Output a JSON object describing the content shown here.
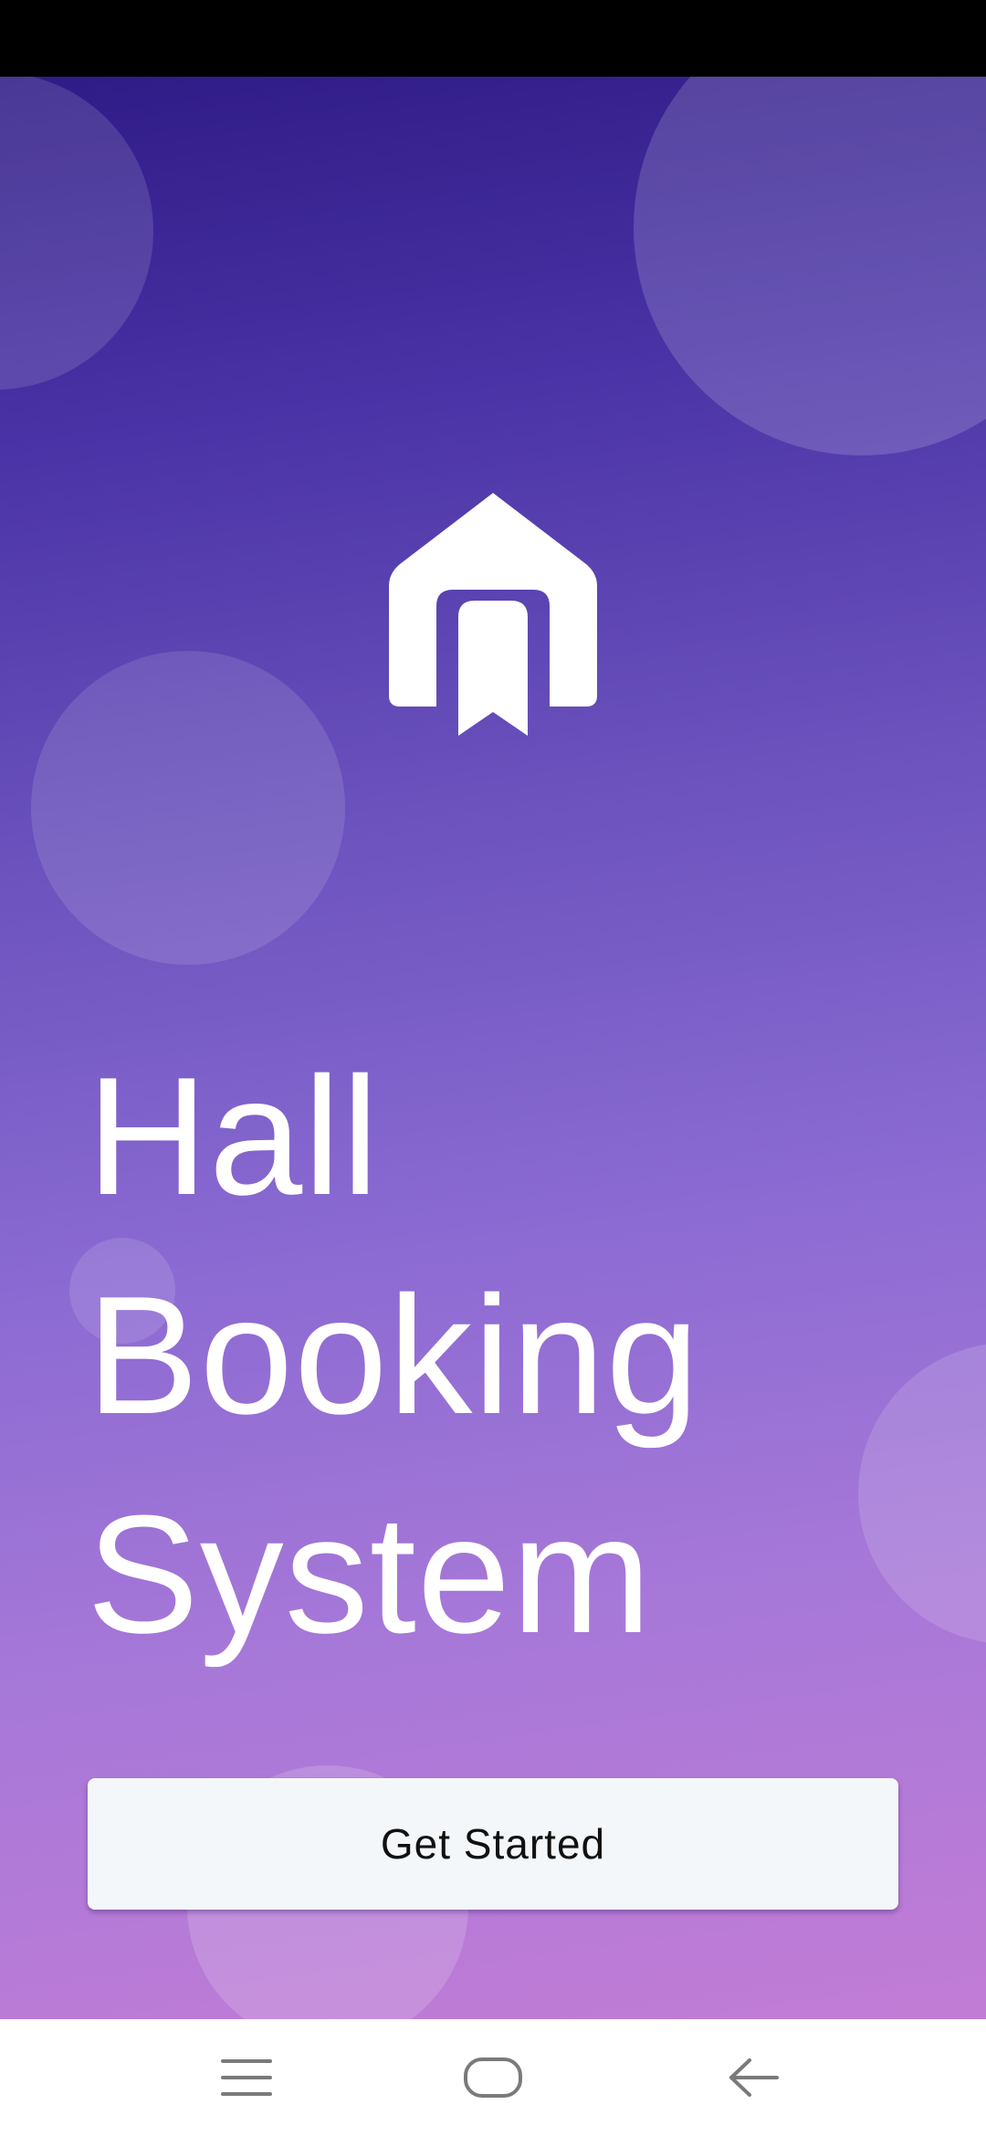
{
  "app": {
    "title_lines": [
      "Hall",
      "Booking",
      "System"
    ],
    "get_started_label": "Get Started",
    "logo_icon": "house-bookmark-icon"
  },
  "system_nav": {
    "menu_icon": "menu-icon",
    "home_icon": "home-pill-icon",
    "back_icon": "back-arrow-icon"
  },
  "colors": {
    "gradient_top": "#2f1b86",
    "gradient_bottom": "#c27cd6",
    "button_bg": "#f4f7f9",
    "button_text": "#111111",
    "title_text": "#ffffff",
    "nav_icon": "#7a7a7a"
  }
}
